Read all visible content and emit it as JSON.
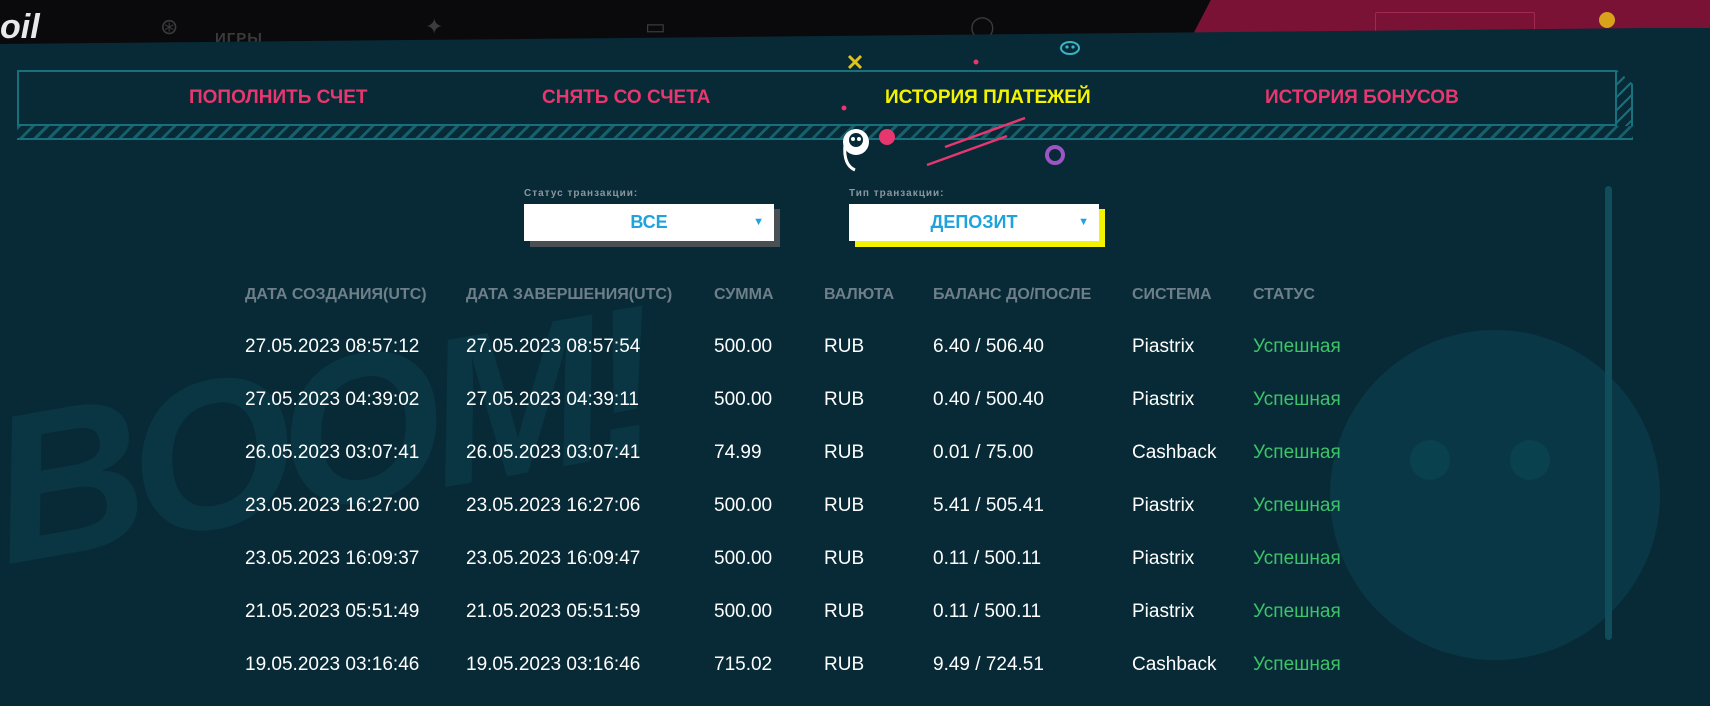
{
  "header": {
    "logo_fragment": "oil",
    "nav_fragment": "ИГРЫ"
  },
  "tabs": [
    {
      "label": "ПОПОЛНИТЬ СЧЕТ",
      "active": false
    },
    {
      "label": "СНЯТЬ СО СЧЕТА",
      "active": false
    },
    {
      "label": "ИСТОРИЯ ПЛАТЕЖЕЙ",
      "active": true
    },
    {
      "label": "ИСТОРИЯ БОНУСОВ",
      "active": false
    }
  ],
  "filters": {
    "status": {
      "label": "Статус транзакции:",
      "value": "ВСЕ"
    },
    "type": {
      "label": "Тип транзакции:",
      "value": "ДЕПОЗИТ"
    }
  },
  "table": {
    "columns": [
      "ДАТА СОЗДАНИЯ(UTC)",
      "ДАТА ЗАВЕРШЕНИЯ(UTC)",
      "СУММА",
      "ВАЛЮТА",
      "БАЛАНС ДО/ПОСЛЕ",
      "СИСТЕМА",
      "СТАТУС"
    ],
    "rows": [
      [
        "27.05.2023 08:57:12",
        "27.05.2023 08:57:54",
        "500.00",
        "RUB",
        "6.40 / 506.40",
        "Piastrix",
        "Успешная"
      ],
      [
        "27.05.2023 04:39:02",
        "27.05.2023 04:39:11",
        "500.00",
        "RUB",
        "0.40 / 500.40",
        "Piastrix",
        "Успешная"
      ],
      [
        "26.05.2023 03:07:41",
        "26.05.2023 03:07:41",
        "74.99",
        "RUB",
        "0.01 / 75.00",
        "Cashback",
        "Успешная"
      ],
      [
        "23.05.2023 16:27:00",
        "23.05.2023 16:27:06",
        "500.00",
        "RUB",
        "5.41 / 505.41",
        "Piastrix",
        "Успешная"
      ],
      [
        "23.05.2023 16:09:37",
        "23.05.2023 16:09:47",
        "500.00",
        "RUB",
        "0.11 / 500.11",
        "Piastrix",
        "Успешная"
      ],
      [
        "21.05.2023 05:51:49",
        "21.05.2023 05:51:59",
        "500.00",
        "RUB",
        "0.11 / 500.11",
        "Piastrix",
        "Успешная"
      ],
      [
        "19.05.2023 03:16:46",
        "19.05.2023 03:16:46",
        "715.02",
        "RUB",
        "9.49 / 724.51",
        "Cashback",
        "Успешная"
      ]
    ]
  },
  "watermark": "BOOM!",
  "colors": {
    "panel_bg": "#072a36",
    "tab_inactive": "#e8366e",
    "tab_active": "#f4f400",
    "select_text": "#1fa3dd",
    "status_success": "#3cc46a",
    "header_text": "#6e7f89"
  }
}
